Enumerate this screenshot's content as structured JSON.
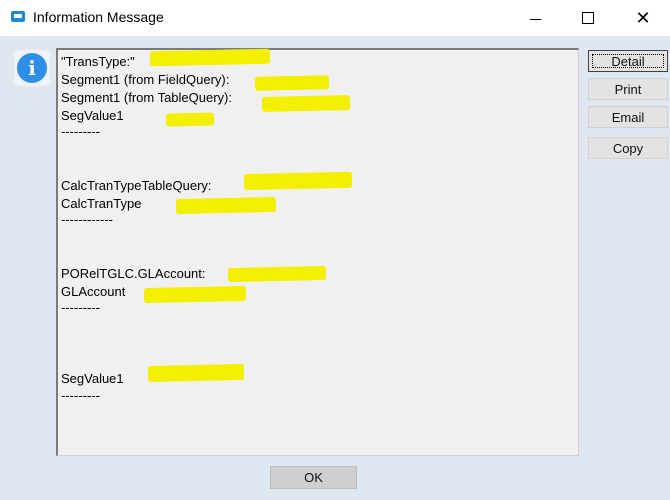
{
  "window": {
    "title": "Information Message",
    "controls": {
      "minimize": "minimize",
      "maximize": "maximize",
      "close": "close"
    }
  },
  "icon": {
    "name": "info-icon",
    "glyph": "i",
    "color": "#2f8fe6"
  },
  "message_lines": [
    "\"TransType:\"",
    "Segment1 (from FieldQuery):",
    "Segment1 (from TableQuery):",
    "SegValue1",
    "---------",
    "CalcTranTypeTableQuery:",
    "CalcTranType",
    "------------",
    "PORelTGLC.GLAccount:",
    "GLAccount",
    "---------",
    "SegValue1",
    "---------"
  ],
  "highlight_color": "#f2ef00",
  "side_buttons": {
    "detail": "Detail",
    "print": "Print",
    "email": "Email",
    "copy": "Copy"
  },
  "ok_button": "OK"
}
